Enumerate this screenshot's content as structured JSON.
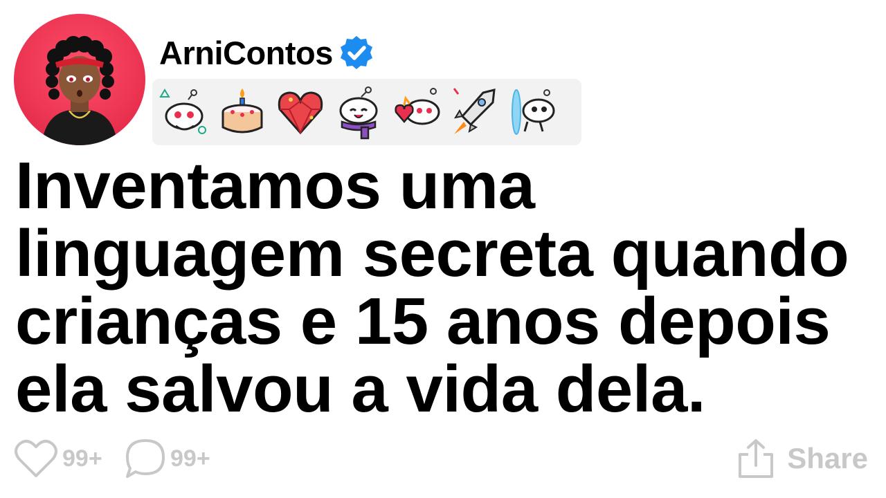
{
  "post": {
    "username": "ArniContos",
    "title_lines": [
      "Inventamos uma",
      "linguagem secreta quando",
      "crianças e 15 anos depois",
      "ela salvou a vida dela."
    ]
  },
  "stats": {
    "likes": "99+",
    "comments": "99+",
    "share_label": "Share"
  },
  "icons": {
    "verified": "verified-check-icon",
    "like": "heart-icon",
    "comment": "comment-bubble-icon",
    "share": "share-icon"
  },
  "colors": {
    "avatar_bg": "#e8304e",
    "verified": "#1d8cf0",
    "muted": "#c8c8c8",
    "badge_bar": "#f2f2f2"
  }
}
